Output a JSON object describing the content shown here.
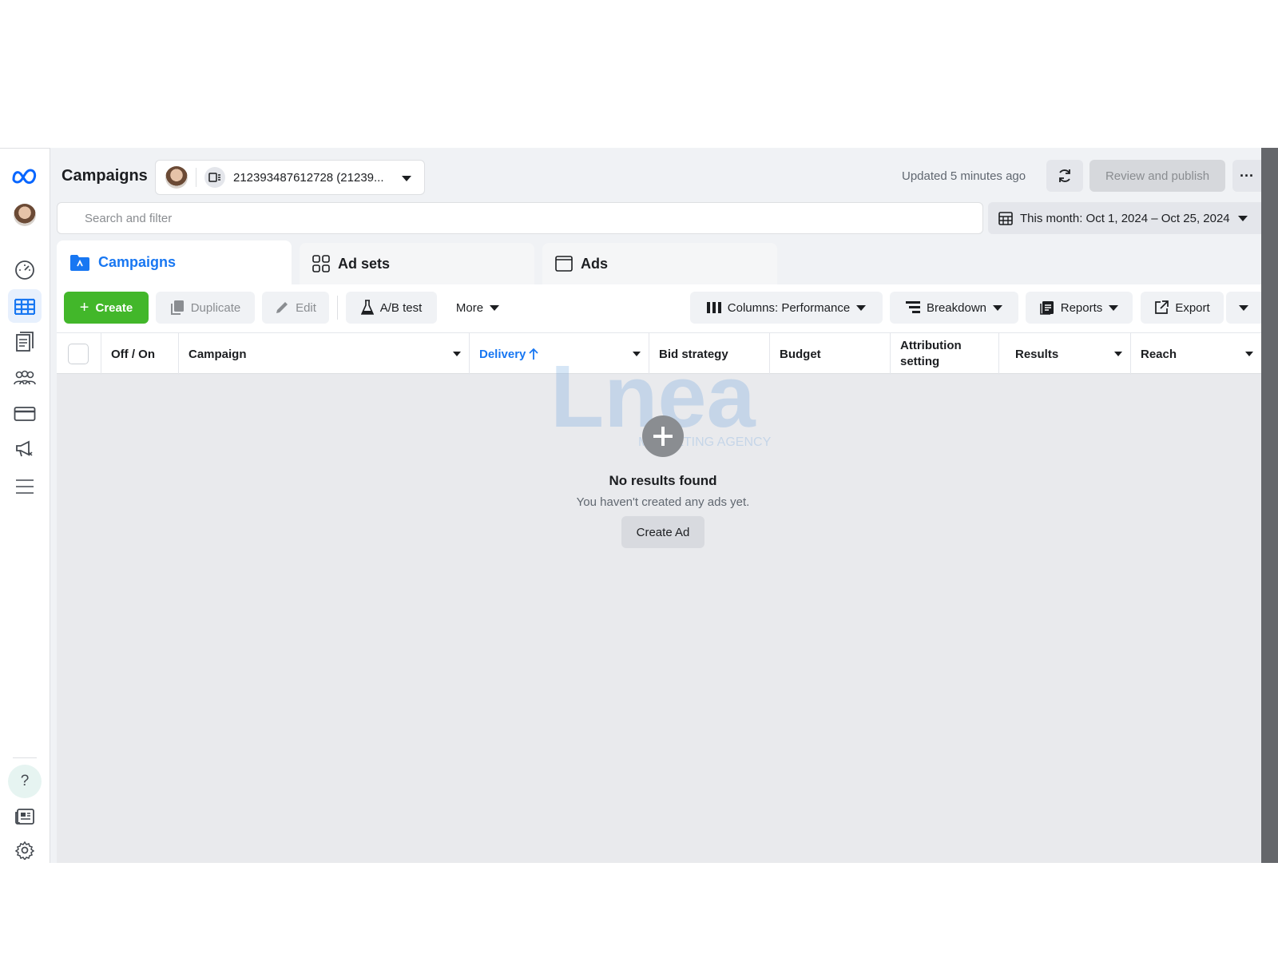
{
  "header": {
    "title": "Campaigns",
    "account_id": "212393487612728 (21239...",
    "updated": "Updated 5 minutes ago",
    "review_publish": "Review and publish",
    "more_dots": "···"
  },
  "search": {
    "placeholder": "Search and filter"
  },
  "date_range": {
    "label": "This month: Oct 1, 2024 – Oct 25, 2024"
  },
  "tabs": [
    {
      "label": "Campaigns",
      "active": true
    },
    {
      "label": "Ad sets",
      "active": false
    },
    {
      "label": "Ads",
      "active": false
    }
  ],
  "toolbar": {
    "create": "Create",
    "duplicate": "Duplicate",
    "edit": "Edit",
    "ab_test": "A/B test",
    "more": "More",
    "columns": "Columns: Performance",
    "breakdown": "Breakdown",
    "reports": "Reports",
    "export": "Export"
  },
  "table": {
    "columns": [
      "Off / On",
      "Campaign",
      "Delivery",
      "Bid strategy",
      "Budget",
      "Attribution setting",
      "Results",
      "Reach"
    ],
    "sorted_column": "Delivery",
    "sort_direction": "ascending"
  },
  "empty_state": {
    "title": "No results found",
    "subtitle": "You haven't created any ads yet.",
    "action": "Create Ad"
  },
  "watermark": {
    "text": "Lnea",
    "tagline": "MARKETING AGENCY"
  },
  "nav": {
    "items": [
      "meta-logo-icon",
      "profile-avatar",
      "dashboard-icon",
      "campaigns-table-icon",
      "pages-icon",
      "audiences-icon",
      "billing-icon",
      "ads-icon",
      "menu-icon",
      "help-icon",
      "news-icon",
      "settings-icon"
    ],
    "active": "campaigns-table-icon"
  },
  "colors": {
    "accent": "#1877f2",
    "create_green": "#42b72a",
    "rail_bg": "#ffffff",
    "panel_bg": "#e9eaed"
  }
}
